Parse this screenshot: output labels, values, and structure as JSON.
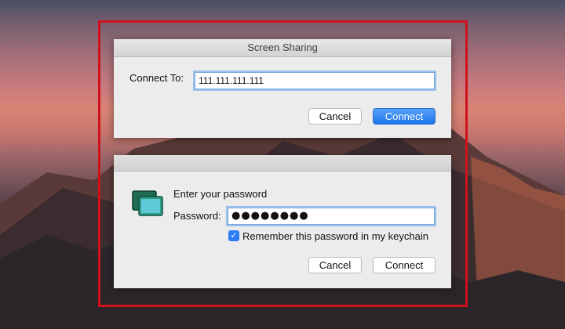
{
  "dialog_connect": {
    "title": "Screen Sharing",
    "connect_to_label": "Connect To:",
    "connect_to_value": "111.111.111.111",
    "cancel_label": "Cancel",
    "connect_label": "Connect"
  },
  "dialog_password": {
    "prompt": "Enter your password",
    "password_label": "Password:",
    "password_value": "●●●●●●●●",
    "remember_checked": true,
    "remember_label": "Remember this password in my keychain",
    "cancel_label": "Cancel",
    "connect_label": "Connect"
  },
  "colors": {
    "highlight_frame": "#d0111b",
    "primary_button": "#1c74ee",
    "focus_ring": "#9cc1ee"
  },
  "icons": {
    "app_icon": "screen-sharing-icon",
    "check_icon": "checkmark-icon"
  }
}
